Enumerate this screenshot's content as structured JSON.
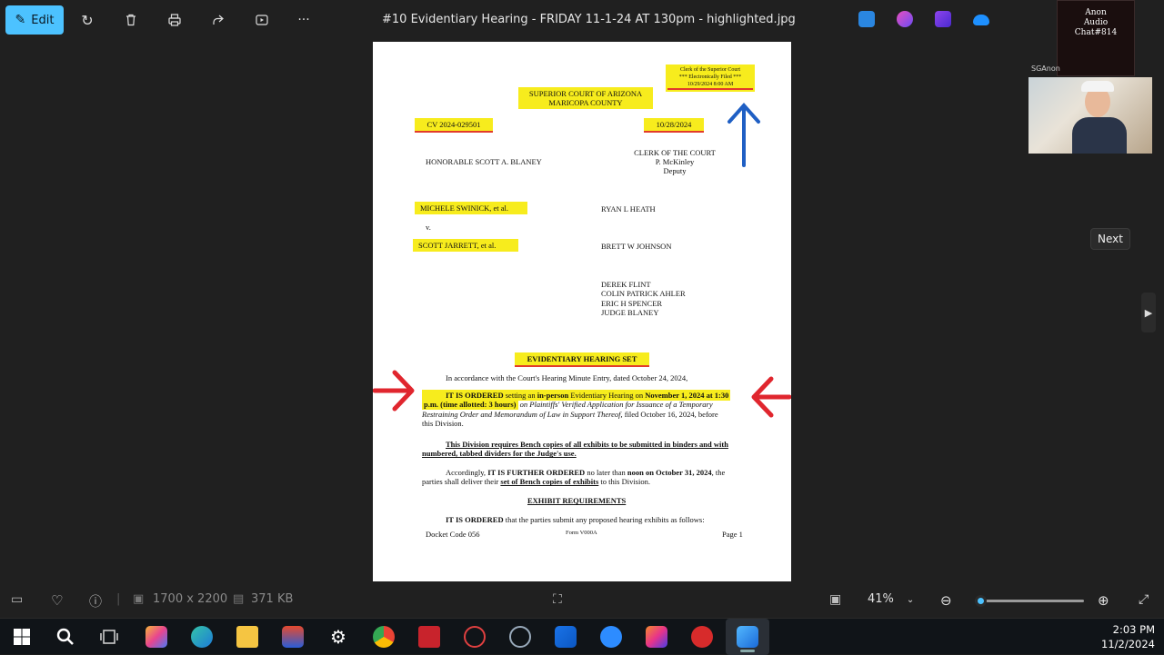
{
  "toolbar": {
    "edit_label": "Edit",
    "title": "#10 Evidentiary Hearing - FRIDAY 11-1-24 AT 130pm - highlighted.jpg",
    "more_label": "···"
  },
  "document": {
    "clerk_stamp": [
      "Clerk of the Superior Court",
      "*** Electronically Filed ***",
      "10/29/2024 8:00 AM"
    ],
    "court": [
      "SUPERIOR COURT OF ARIZONA",
      "MARICOPA COUNTY"
    ],
    "case_no": "CV 2024-029501",
    "date": "10/28/2024",
    "judge": "HONORABLE SCOTT A. BLANEY",
    "clerk": [
      "CLERK OF THE COURT",
      "P. McKinley",
      "Deputy"
    ],
    "plaintiff": "MICHELE SWINICK, et al.",
    "v": "v.",
    "defendant": "SCOTT JARRETT, et al.",
    "counsel_1": "RYAN L HEATH",
    "counsel_2": "BRETT W JOHNSON",
    "others": [
      "DEREK FLINT",
      "COLIN PATRICK AHLER",
      "ERIC H SPENCER",
      "JUDGE BLANEY"
    ],
    "heading": "EVIDENTIARY HEARING SET",
    "para1": "In accordance with the Court's Hearing Minute Entry, dated October 24, 2024,",
    "ordered_a": "IT IS ORDERED",
    "ordered_b": " setting an ",
    "ordered_c": "in-person",
    "ordered_d": " Evidentiary Hearing on ",
    "ordered_e": "November 1, 2024 at 1:30",
    "ordered_f": "p.m. (time allotted: 3 hours)",
    "ordered_g": " on Plaintiffs' Verified Application for Issuance of a Temporary",
    "ordered_h": "Restraining Order and Memorandum of Law in Support Thereof,",
    "ordered_i": " filed October 16, 2024, before",
    "ordered_j": "this Division.",
    "bench_1": "This Division requires Bench copies of all exhibits to be submitted in binders and with",
    "bench_2": "numbered, tabbed dividers for the Judge's use.",
    "further_a": "Accordingly, ",
    "further_b": "IT IS FURTHER ORDERED",
    "further_c": " no later than ",
    "further_d": "noon on October 31, 2024",
    "further_e": ", the",
    "further_f": "parties shall deliver their ",
    "further_g": "set of Bench copies of exhibits",
    "further_h": " to this Division.",
    "exhibit_heading": "EXHIBIT REQUIREMENTS",
    "final_a": "IT IS ORDERED",
    "final_b": " that the parties submit any proposed hearing exhibits as follows:",
    "footer_left": "Docket Code 056",
    "footer_mid": "Form V000A",
    "footer_right": "Page 1"
  },
  "overlay": {
    "cam1_text": [
      "Anon",
      "Audio",
      "Chat#814"
    ],
    "cam_label": "SGAnon",
    "next_label": "Next"
  },
  "status": {
    "dimensions": "1700 x 2200",
    "filesize": "371 KB",
    "zoom": "41%",
    "zoom_fraction": 0.05
  },
  "taskbar": {
    "time": "2:03 PM",
    "date": "11/2/2024"
  },
  "colors": {
    "accent": "#4cc2ff",
    "highlight": "#f7ec1d",
    "red_arrow": "#e0262e",
    "blue_arrow": "#1f5fc4"
  }
}
